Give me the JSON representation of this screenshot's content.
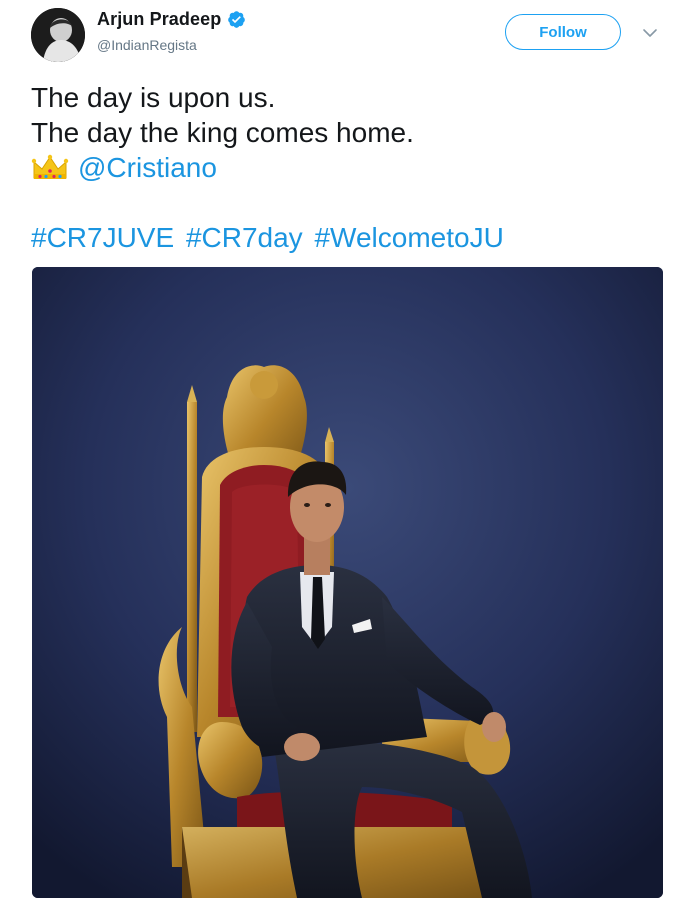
{
  "author": {
    "display_name": "Arjun Pradeep",
    "handle": "@IndianRegista",
    "verified": true
  },
  "actions": {
    "follow_label": "Follow"
  },
  "tweet": {
    "line1": "The day is upon us.",
    "line2": "The day the king comes home.",
    "emoji": "crown-icon",
    "mention": "@Cristiano",
    "hashtags": [
      "#CR7JUVE",
      "#CR7day",
      "#WelcometoJU"
    ]
  },
  "colors": {
    "link": "#1b95e0",
    "follow_accent": "#1da1f2",
    "name_text": "#14171a",
    "handle_text": "#657786",
    "photo_background": "#1c2540"
  },
  "media": {
    "kind": "photo",
    "icon": "photo-man-on-throne"
  }
}
